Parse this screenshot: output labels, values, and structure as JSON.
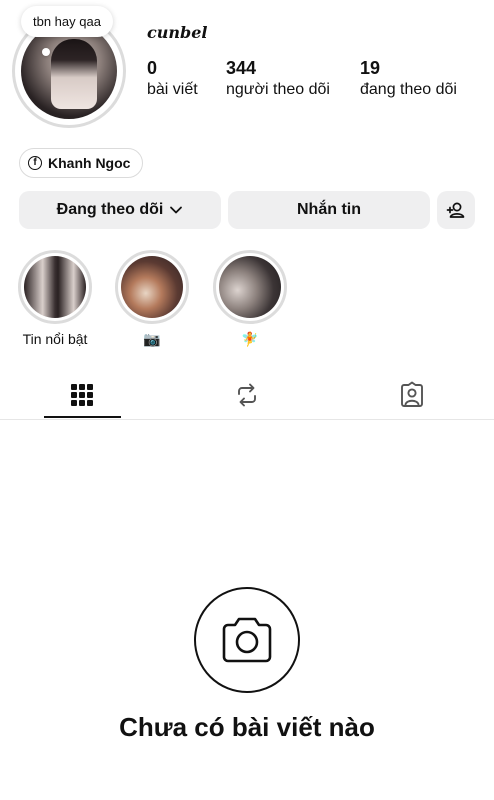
{
  "profile": {
    "note": "tbn hay qaa",
    "username": "cunbel",
    "stats": [
      {
        "value": "0",
        "label": "bài viết"
      },
      {
        "value": "344",
        "label": "người theo dõi"
      },
      {
        "value": "19",
        "label": "đang theo dõi"
      }
    ],
    "link_label": "Khanh Ngoc"
  },
  "actions": {
    "following_label": "Đang theo dõi",
    "message_label": "Nhắn tin"
  },
  "highlights": [
    {
      "label": "Tin nổi bật"
    },
    {
      "label": "📷"
    },
    {
      "label": "🧚"
    }
  ],
  "tabs": [
    "grid-icon",
    "reposts-icon",
    "tagged-icon"
  ],
  "empty_state": {
    "title": "Chưa có bài viết nào"
  }
}
